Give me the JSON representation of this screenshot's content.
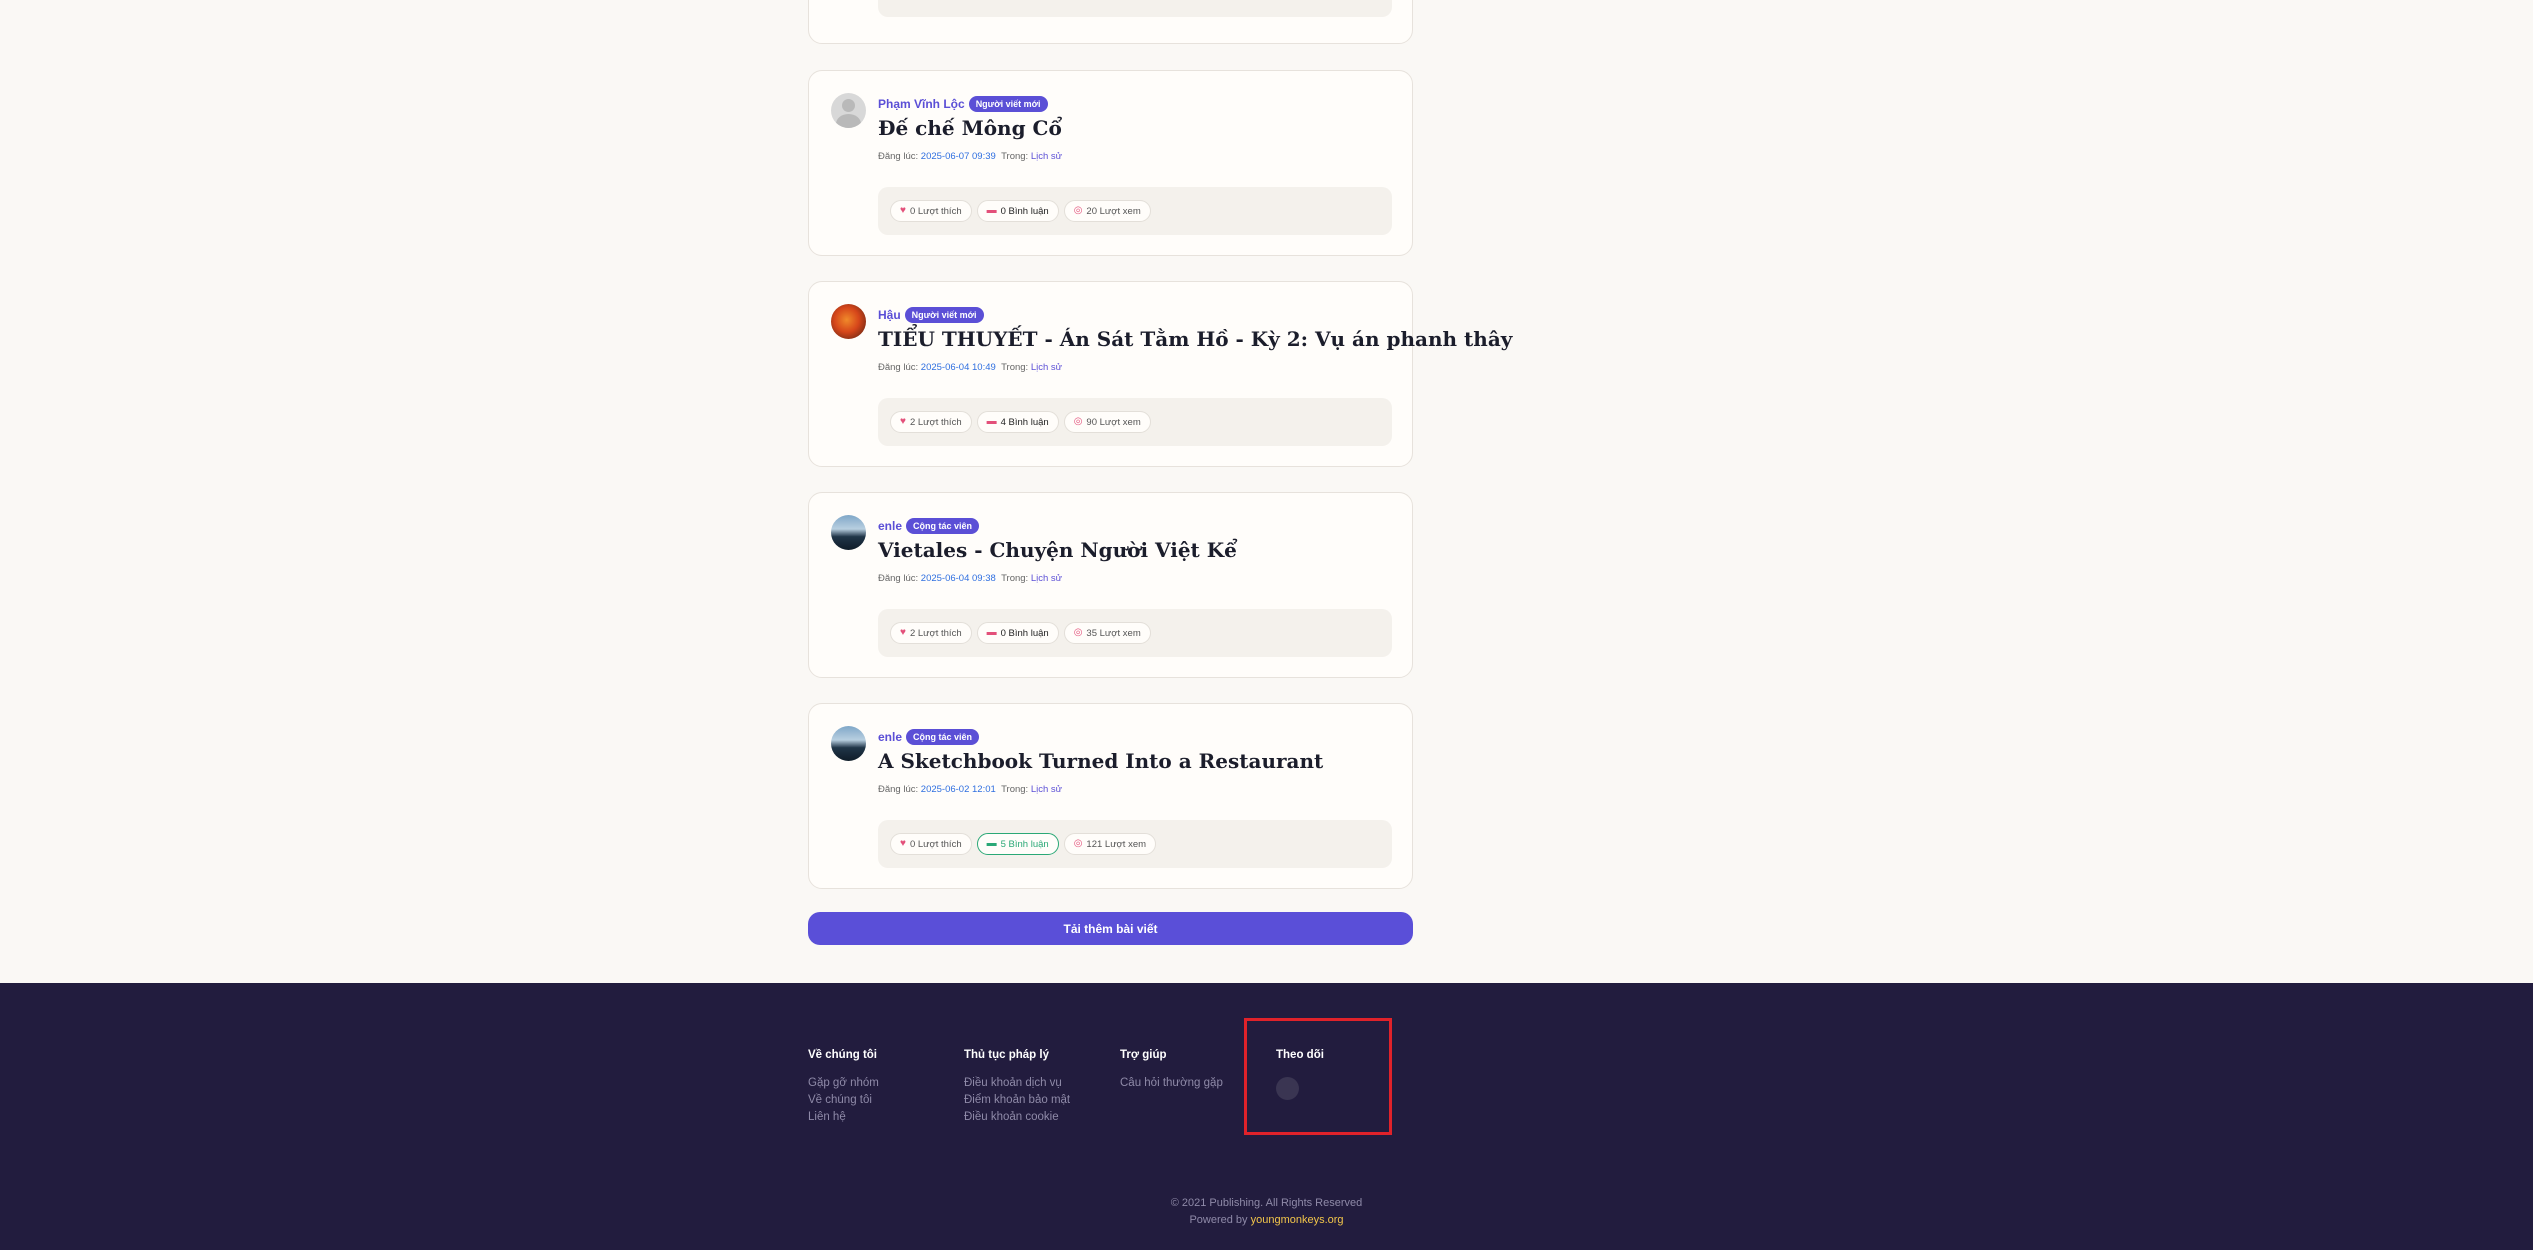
{
  "posts": [
    {
      "author": "Phạm Vĩnh Lộc",
      "badge": "Người viết mới",
      "title": "Đế chế Mông Cổ",
      "posted_label": "Đăng lúc:",
      "date": "2025-06-07 09:39",
      "in_label": "Trong:",
      "category": "Lịch sử",
      "likes": "0 Lượt thích",
      "comments": "0 Bình luận",
      "views": "20 Lượt xem"
    },
    {
      "author": "Hậu",
      "badge": "Người viết mới",
      "title": "TIỂU THUYẾT - Án Sát Tằm Hồ - Kỳ 2: Vụ án phanh thây",
      "posted_label": "Đăng lúc:",
      "date": "2025-06-04 10:49",
      "in_label": "Trong:",
      "category": "Lịch sử",
      "likes": "2 Lượt thích",
      "comments": "4 Bình luận",
      "views": "90 Lượt xem"
    },
    {
      "author": "enle",
      "badge": "Cộng tác viên",
      "title": "Vietales - Chuyện Người Việt Kể",
      "posted_label": "Đăng lúc:",
      "date": "2025-06-04 09:38",
      "in_label": "Trong:",
      "category": "Lịch sử",
      "likes": "2 Lượt thích",
      "comments": "0 Bình luận",
      "views": "35 Lượt xem"
    },
    {
      "author": "enle",
      "badge": "Cộng tác viên",
      "title": "A Sketchbook Turned Into a Restaurant",
      "posted_label": "Đăng lúc:",
      "date": "2025-06-02 12:01",
      "in_label": "Trong:",
      "category": "Lịch sử",
      "likes": "0 Lượt thích",
      "comments": "5 Bình luận",
      "views": "121 Lượt xem"
    }
  ],
  "load_more": "Tải thêm bài viết",
  "footer": {
    "about": {
      "heading": "Về chúng tôi",
      "links": [
        "Gặp gỡ nhóm",
        "Về chúng tôi",
        "Liên hệ"
      ]
    },
    "legal": {
      "heading": "Thủ tục pháp lý",
      "links": [
        "Điều khoản dịch vụ",
        "Điểm khoản bảo mật",
        "Điều khoản cookie"
      ]
    },
    "help": {
      "heading": "Trợ giúp",
      "links": [
        "Câu hỏi thường gặp"
      ]
    },
    "follow": {
      "heading": "Theo dõi"
    },
    "copyright": "© 2021 Publishing. All Rights Reserved",
    "powered_label": "Powered by",
    "powered_brand": "youngmonkeys.org"
  },
  "icons": {
    "like": "heart-icon",
    "comment": "comment-icon",
    "view": "eye-icon"
  },
  "colors": {
    "accent": "#5b4fd6",
    "footer_bg": "#221c3e",
    "highlight": "#e0222a",
    "brand_link": "#f2c54a"
  }
}
